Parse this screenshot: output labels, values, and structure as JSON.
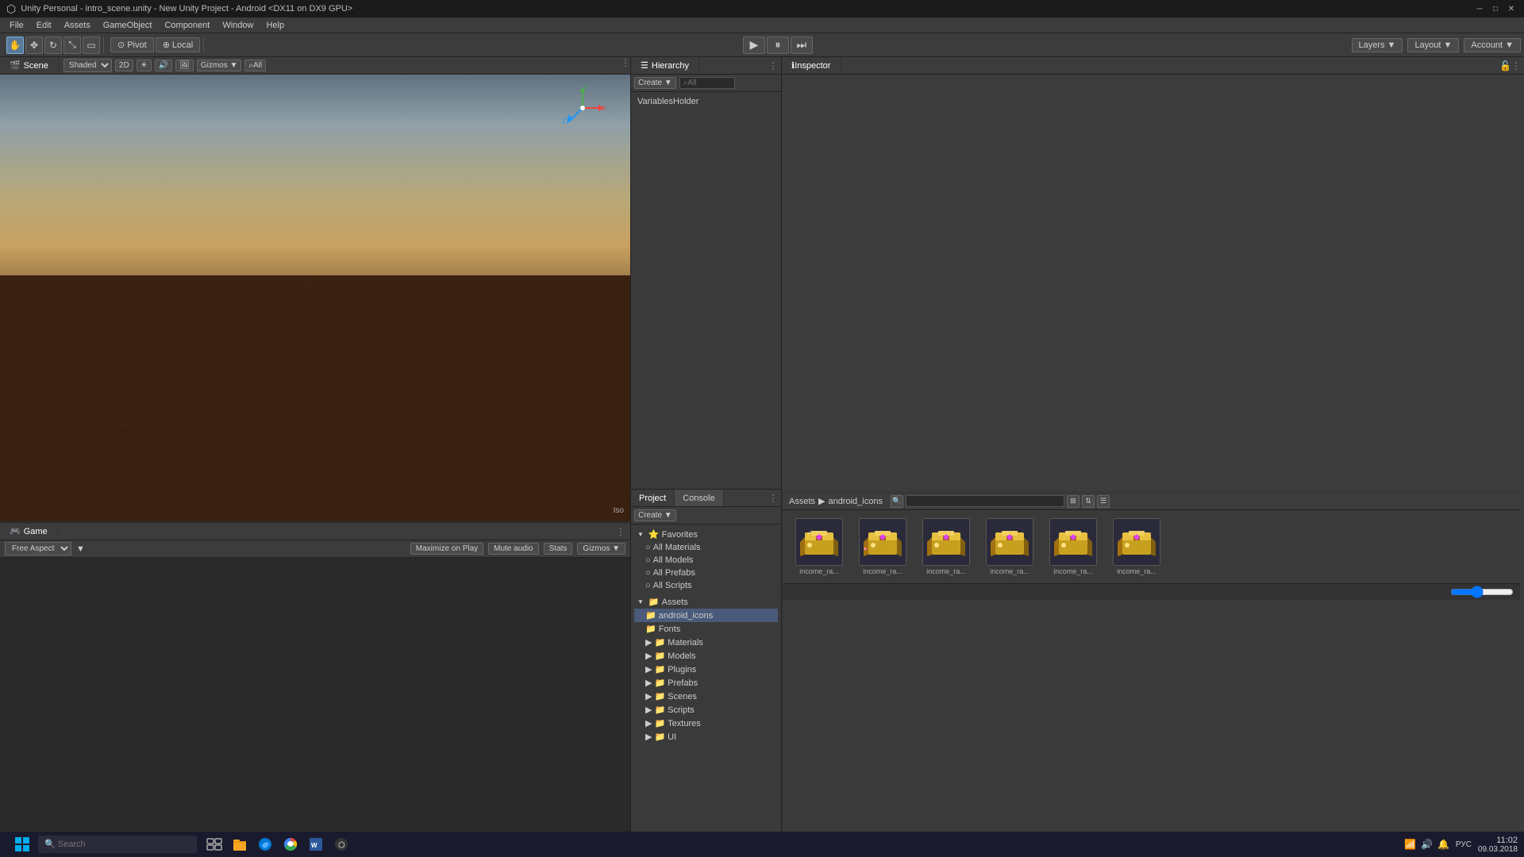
{
  "title_bar": {
    "text": "Unity Personal - intro_scene.unity - New Unity Project - Android <DX11 on DX9 GPU>",
    "minimize": "─",
    "maximize": "□",
    "close": "✕"
  },
  "menu": {
    "items": [
      "File",
      "Edit",
      "Assets",
      "GameObject",
      "Component",
      "Window",
      "Help"
    ]
  },
  "toolbar": {
    "pivot_label": "Pivot",
    "local_label": "Local",
    "layers_label": "Layers",
    "layout_label": "Layout",
    "account_label": "Account"
  },
  "scene_panel": {
    "tab_label": "Scene",
    "shading_mode": "Shaded",
    "view_2d": "2D",
    "gizmos_label": "Gizmos",
    "all_label": "All",
    "iso_label": "Iso",
    "x_axis": "X",
    "y_axis": "Y",
    "z_axis": "Z"
  },
  "game_panel": {
    "tab_label": "Game",
    "aspect_label": "Free Aspect",
    "maximize_label": "Maximize on Play",
    "mute_label": "Mute audio",
    "stats_label": "Stats",
    "gizmos_label": "Gizmos"
  },
  "hierarchy_panel": {
    "title": "Hierarchy",
    "create_label": "Create",
    "search_placeholder": "All",
    "items": [
      {
        "name": "VariablesHolder",
        "indent": 0
      }
    ]
  },
  "inspector_panel": {
    "title": "Inspector"
  },
  "project_panel": {
    "tabs": [
      "Project",
      "Console"
    ],
    "create_label": "Create",
    "breadcrumb": {
      "root": "Assets",
      "separator": "▶",
      "current": "android_icons"
    },
    "search_placeholder": "",
    "tree": {
      "favorites": {
        "label": "Favorites",
        "children": [
          {
            "label": "All Materials",
            "icon": "○"
          },
          {
            "label": "All Models",
            "icon": "○"
          },
          {
            "label": "All Prefabs",
            "icon": "○"
          },
          {
            "label": "All Scripts",
            "icon": "○"
          }
        ]
      },
      "assets": {
        "label": "Assets",
        "children": [
          {
            "label": "android_icons",
            "icon": "📁",
            "selected": true
          },
          {
            "label": "Fonts",
            "icon": "📁"
          },
          {
            "label": "Materials",
            "icon": "📁",
            "has_arrow": true
          },
          {
            "label": "Models",
            "icon": "📁",
            "has_arrow": true
          },
          {
            "label": "Plugins",
            "icon": "📁",
            "has_arrow": true
          },
          {
            "label": "Prefabs",
            "icon": "📁",
            "has_arrow": true
          },
          {
            "label": "Scenes",
            "icon": "📁",
            "has_arrow": true
          },
          {
            "label": "Scripts",
            "icon": "📁",
            "has_arrow": true
          },
          {
            "label": "Textures",
            "icon": "📁",
            "has_arrow": true
          },
          {
            "label": "UI",
            "icon": "📁",
            "has_arrow": true
          }
        ]
      }
    },
    "assets": [
      {
        "label": "income_ra..."
      },
      {
        "label": "income_ra..."
      },
      {
        "label": "income_ra..."
      },
      {
        "label": "income_ra..."
      },
      {
        "label": "income_ra..."
      },
      {
        "label": "income_ra..."
      }
    ]
  },
  "taskbar": {
    "time": "11:02",
    "date": "09.03.2018",
    "language": "РУС"
  }
}
